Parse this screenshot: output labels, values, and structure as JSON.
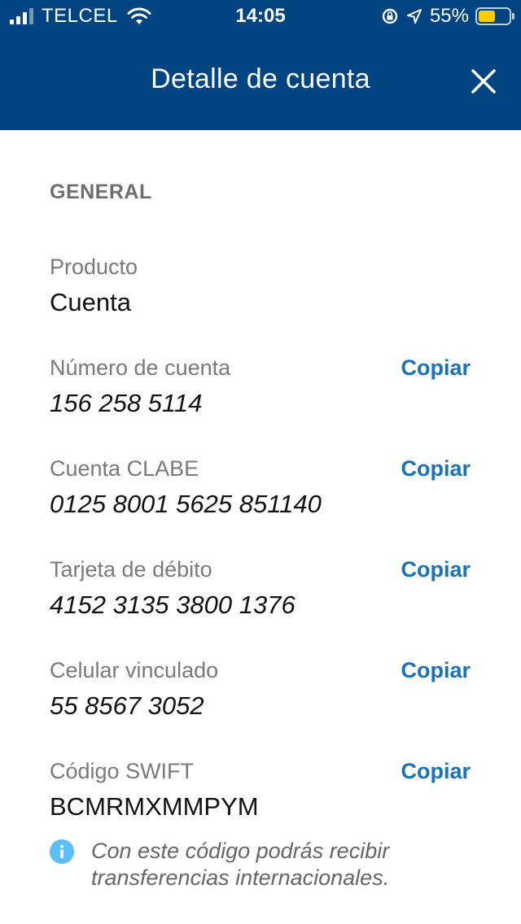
{
  "status_bar": {
    "carrier": "TELCEL",
    "time": "14:05",
    "battery_percent": "55%",
    "battery_level": 0.55,
    "signal_bars": 3
  },
  "header": {
    "title": "Detalle de cuenta",
    "close_icon": "close-icon"
  },
  "section": {
    "title": "GENERAL"
  },
  "fields": [
    {
      "label": "Producto",
      "value": "Cuenta"
    },
    {
      "label": "Número de cuenta",
      "value": "156 258 5114",
      "action": "Copiar"
    },
    {
      "label": "Cuenta CLABE",
      "value": "0125 8001 5625 851140",
      "action": "Copiar"
    },
    {
      "label": "Tarjeta de débito",
      "value": "4152 3135 3800 1376",
      "action": "Copiar"
    },
    {
      "label": "Celular vinculado",
      "value": "55 8567 3052",
      "action": "Copiar"
    },
    {
      "label": "Código SWIFT",
      "value": "BCMRMXMMPYM",
      "action": "Copiar"
    }
  ],
  "info": {
    "icon": "info-icon",
    "text_line1": "Con este código podrás recibir",
    "text_line2": "transferencias internacionales."
  },
  "colors": {
    "header_bg": "#004481",
    "accent": "#1973b8",
    "battery": "#ffcc00",
    "info_icon": "#5bbeff"
  }
}
